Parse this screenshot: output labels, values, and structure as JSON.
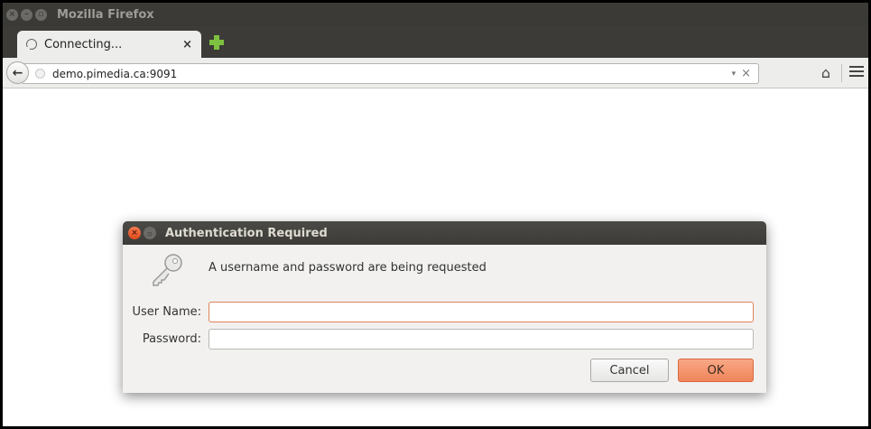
{
  "window": {
    "title": "Mozilla Firefox",
    "controls": [
      "close-icon",
      "minimize-icon",
      "maximize-icon"
    ]
  },
  "tab": {
    "title": "Connecting...",
    "close_label": "×",
    "spinner_icon": "loading-spinner-icon",
    "new_tab_icon": "plus-icon",
    "new_tab_color": "#7ec140"
  },
  "navbar": {
    "back_label": "←",
    "url": "demo.pimedia.ca:9091",
    "dropdown_label": "▾",
    "clear_label": "×",
    "home_label": "⌂",
    "menu_icon": "hamburger-menu-icon"
  },
  "dialog": {
    "title": "Authentication Required",
    "message": "A username and password are being requested",
    "icon": "key-icon",
    "username_label": "User Name:",
    "username_value": "",
    "password_label": "Password:",
    "password_value": "",
    "cancel_label": "Cancel",
    "ok_label": "OK",
    "accent_color": "#f0855a"
  }
}
